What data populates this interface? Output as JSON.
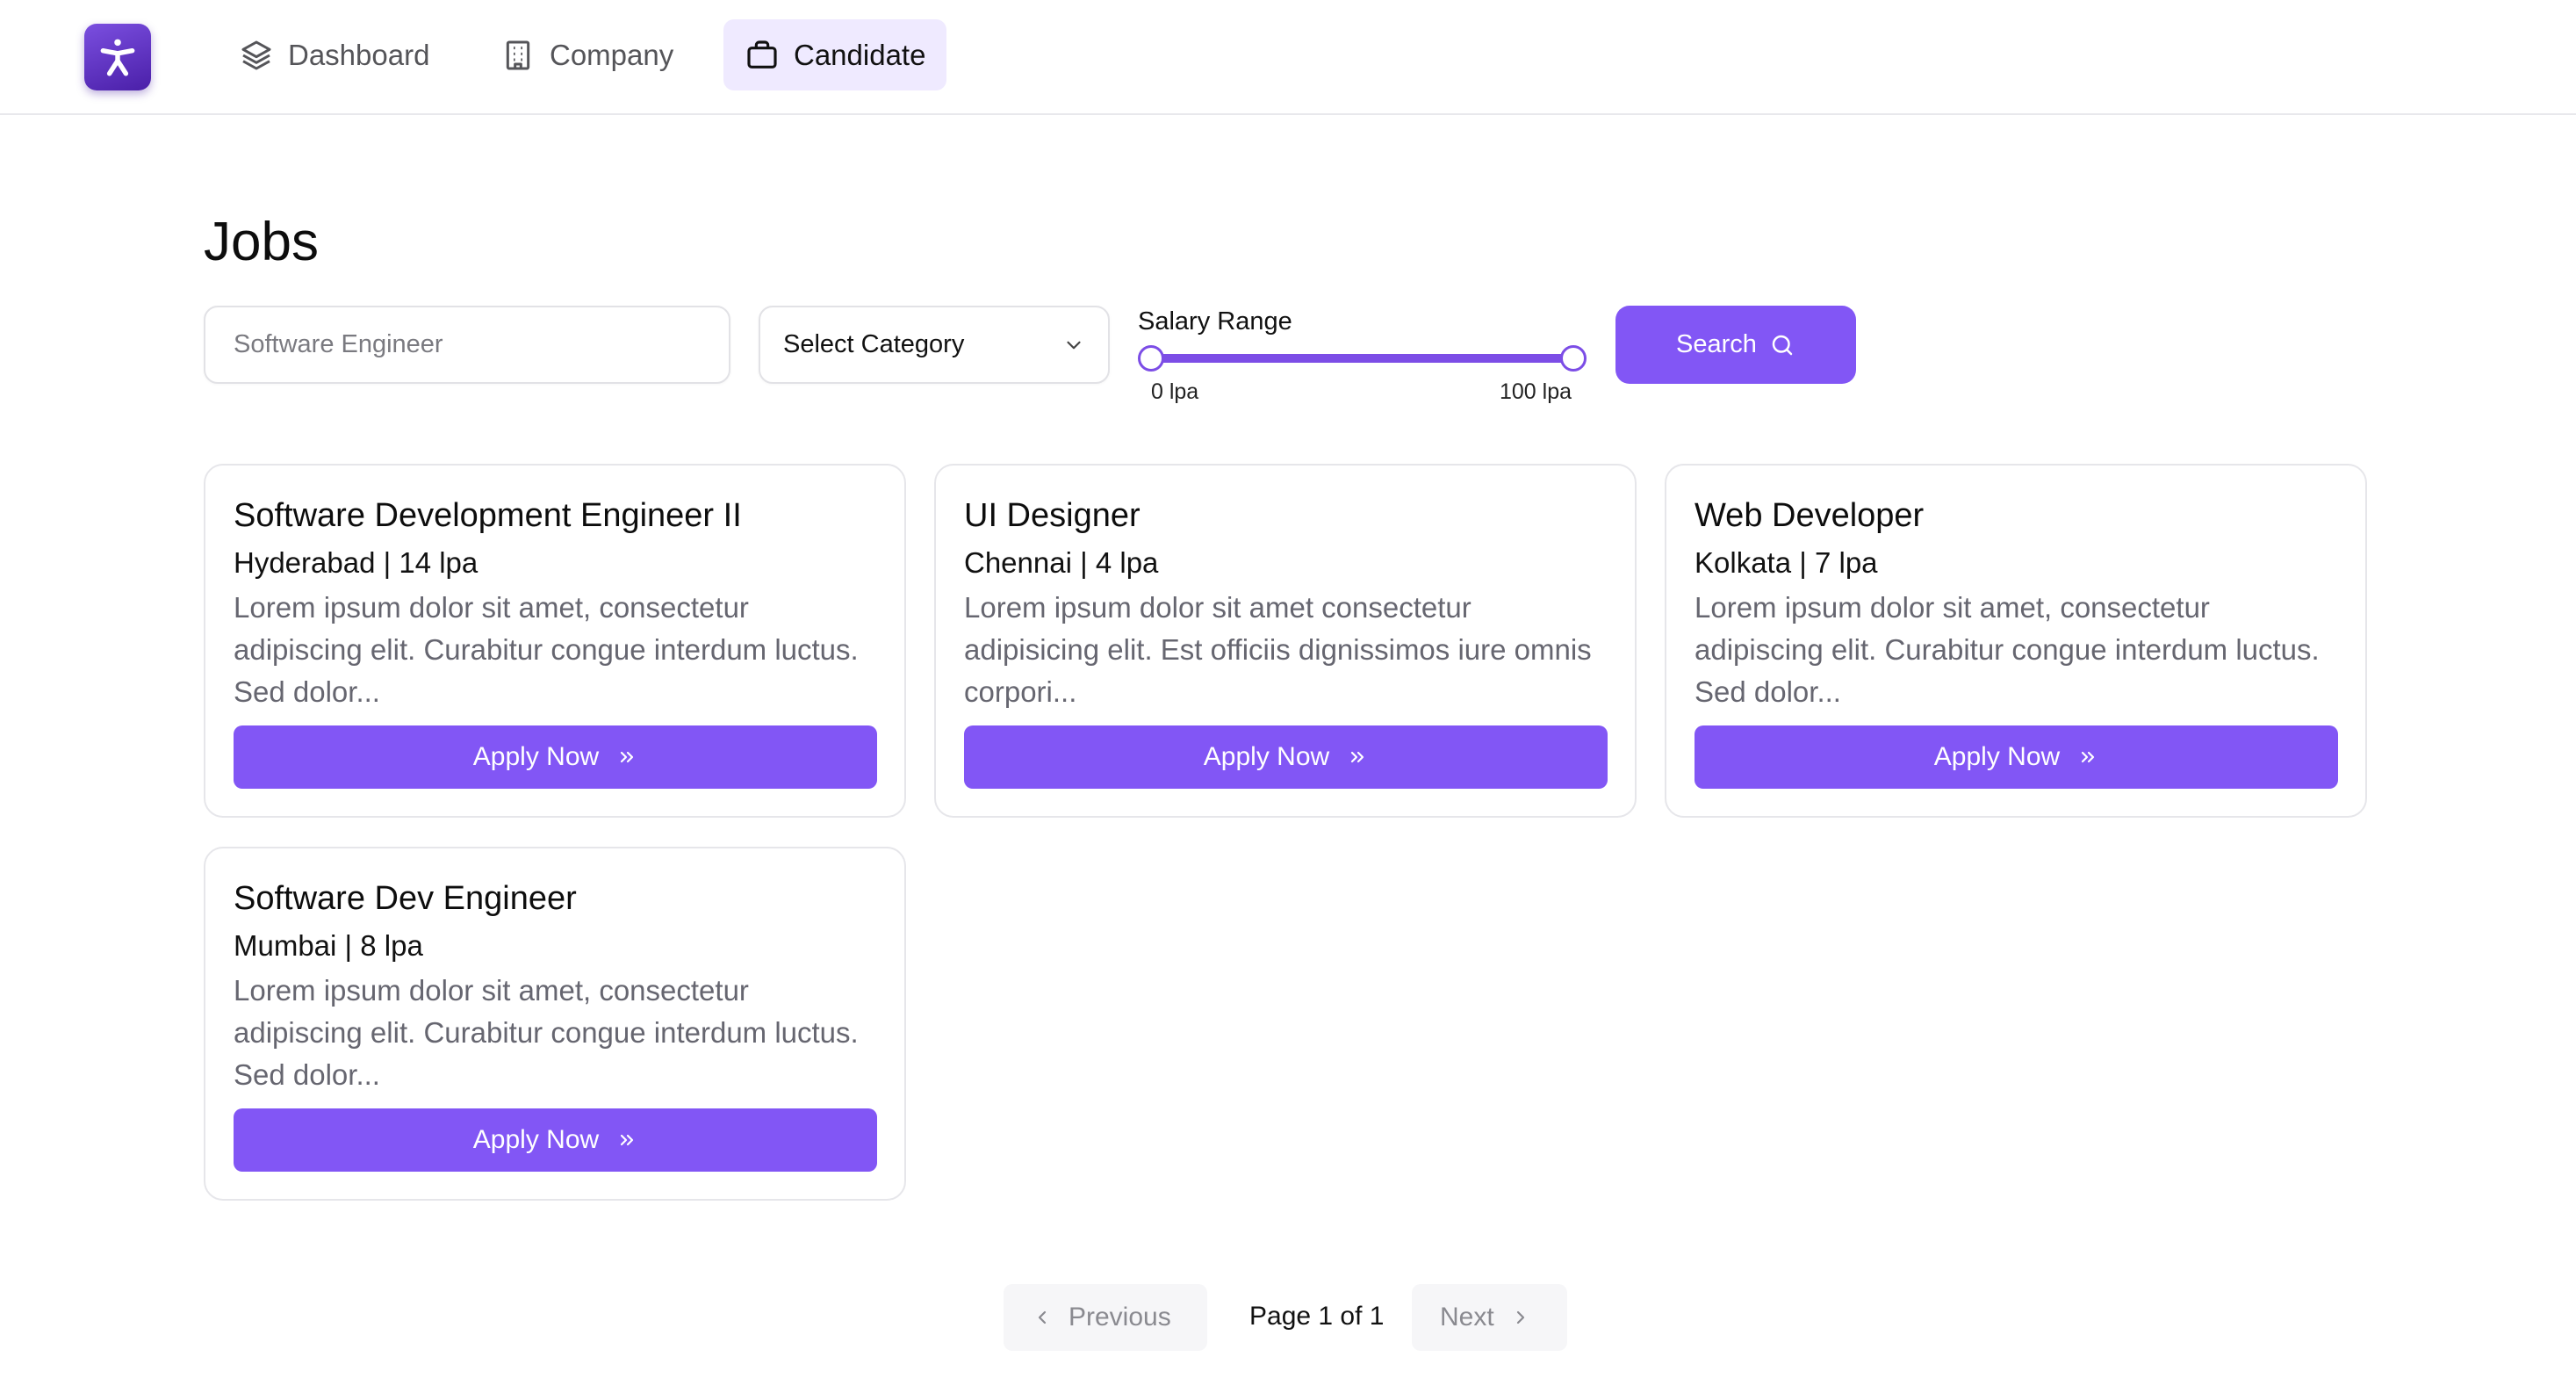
{
  "nav": {
    "items": [
      {
        "label": "Dashboard",
        "icon": "layers-icon"
      },
      {
        "label": "Company",
        "icon": "building-icon"
      },
      {
        "label": "Candidate",
        "icon": "briefcase-icon",
        "active": true
      }
    ]
  },
  "page": {
    "title": "Jobs"
  },
  "filters": {
    "search_placeholder": "Software Engineer",
    "category_label": "Select Category",
    "salary_label": "Salary Range",
    "salary_min_label": "0 lpa",
    "salary_max_label": "100 lpa",
    "search_button": "Search"
  },
  "jobs": [
    {
      "title": "Software Development Engineer II",
      "meta": "Hyderabad | 14 lpa",
      "description": "Lorem ipsum dolor sit amet, consectetur adipiscing elit. Curabitur congue interdum luctus. Sed dolor...",
      "button": "Apply Now"
    },
    {
      "title": "UI Designer",
      "meta": "Chennai | 4 lpa",
      "description": "Lorem ipsum dolor sit amet consectetur adipisicing elit. Est officiis dignissimos iure omnis corpori...",
      "button": "Apply Now"
    },
    {
      "title": "Web Developer",
      "meta": "Kolkata | 7 lpa",
      "description": "Lorem ipsum dolor sit amet, consectetur adipiscing elit. Curabitur congue interdum luctus. Sed dolor...",
      "button": "Apply Now"
    },
    {
      "title": "Software Dev Engineer",
      "meta": "Mumbai | 8 lpa",
      "description": "Lorem ipsum dolor sit amet, consectetur adipiscing elit. Curabitur congue interdum luctus. Sed dolor...",
      "button": "Apply Now"
    }
  ],
  "pagination": {
    "previous": "Previous",
    "status": "Page 1 of 1",
    "next": "Next"
  },
  "colors": {
    "accent": "#8256f5",
    "active_nav_bg": "#efeaff"
  }
}
